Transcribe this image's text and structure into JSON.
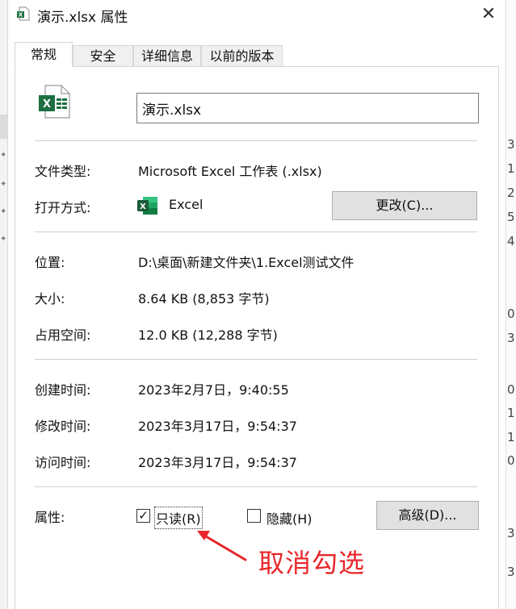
{
  "window": {
    "title": "演示.xlsx 属性",
    "close_glyph": "✕"
  },
  "tabs": [
    {
      "label": "常规",
      "active": true
    },
    {
      "label": "安全",
      "active": false
    },
    {
      "label": "详细信息",
      "active": false
    },
    {
      "label": "以前的版本",
      "active": false
    }
  ],
  "file": {
    "name_value": "演示.xlsx",
    "icon_letter": "X"
  },
  "rows": {
    "type": {
      "label": "文件类型:",
      "value": "Microsoft Excel 工作表 (.xlsx)"
    },
    "opens_with": {
      "label": "打开方式:",
      "value": "Excel",
      "change_button": "更改(C)..."
    },
    "location": {
      "label": "位置:",
      "value": "D:\\桌面\\新建文件夹\\1.Excel测试文件"
    },
    "size": {
      "label": "大小:",
      "value": "8.64 KB (8,853 字节)"
    },
    "size_on_disk": {
      "label": "占用空间:",
      "value": "12.0 KB (12,288 字节)"
    },
    "created": {
      "label": "创建时间:",
      "value": "2023年2月7日，9:40:55"
    },
    "modified": {
      "label": "修改时间:",
      "value": "2023年3月17日，9:54:37"
    },
    "accessed": {
      "label": "访问时间:",
      "value": "2023年3月17日，9:54:37"
    }
  },
  "attributes": {
    "label": "属性:",
    "readonly": {
      "label": "只读(R)",
      "checked": true,
      "check_glyph": "✓"
    },
    "hidden": {
      "label": "隐藏(H)",
      "checked": false
    },
    "advanced_button": "高级(D)..."
  },
  "annotation": {
    "text": "取消勾选",
    "color": "#e8262a"
  },
  "background": {
    "right_digits": [
      "3",
      "1",
      "2",
      "5",
      "4",
      "0",
      "3",
      "0",
      "1",
      "1",
      "0",
      "3",
      "3"
    ],
    "left_pins": [
      "✦",
      "✦",
      "✦",
      "✦"
    ]
  },
  "colors": {
    "excel_green": "#1d6f42",
    "accent_red": "#e8262a"
  }
}
